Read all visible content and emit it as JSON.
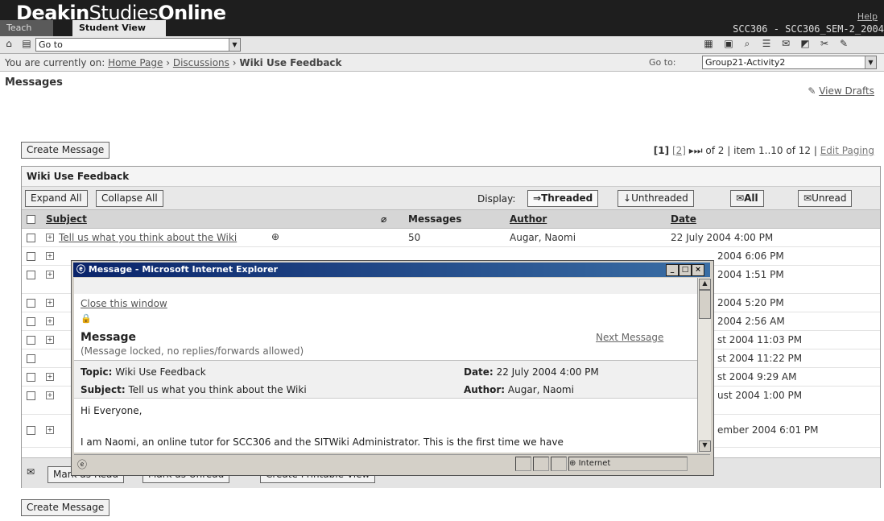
{
  "header": {
    "brand_part1": "Deakin",
    "brand_part2": "Studies",
    "brand_part3": "Online",
    "help": "Help",
    "tabs": [
      "Teach",
      "Student View"
    ],
    "course": "SCC306 - SCC306_SEM-2_2004"
  },
  "toolbar": {
    "goto_value": "Go to"
  },
  "breadcrumb": {
    "prefix": "You are currently on:",
    "items": [
      "Home Page",
      "Discussions"
    ],
    "current": "Wiki Use Feedback",
    "goto_label": "Go to:",
    "goto_value": "Group21-Activity2"
  },
  "page": {
    "title": "Messages",
    "view_drafts": "View Drafts",
    "create_message": "Create Message",
    "paging": {
      "current": "[1]",
      "next": "[2]",
      "of": "of 2 | item 1..10 of 12 |",
      "edit": "Edit Paging"
    }
  },
  "panel": {
    "title": "Wiki Use Feedback",
    "expand_all": "Expand All",
    "collapse_all": "Collapse All",
    "display_label": "Display:",
    "threaded": "Threaded",
    "unthreaded": "Unthreaded",
    "all": "All",
    "unread": "Unread",
    "columns": {
      "subject": "Subject",
      "messages": "Messages",
      "author": "Author",
      "date": "Date"
    },
    "rows": [
      {
        "subject": "Tell us what you think about the Wiki",
        "messages": "50",
        "author": "Augar, Naomi",
        "date": "22 July 2004 4:00 PM"
      },
      {
        "date": "2004 6:06 PM"
      },
      {
        "date": "2004 1:51 PM"
      },
      {
        "date": "2004 5:20 PM"
      },
      {
        "date": "2004 2:56 AM"
      },
      {
        "date": "st 2004 11:03 PM"
      },
      {
        "date": "st 2004 11:22 PM"
      },
      {
        "date": "st 2004 9:29 AM"
      },
      {
        "date": "ust 2004 1:00 PM"
      },
      {
        "date": "ember 2004 6:01 PM"
      }
    ],
    "mark_read": "Mark as Read",
    "mark_unread": "Mark as Unread",
    "printable": "Create Printable View"
  },
  "popup": {
    "title": "Message - Microsoft Internet Explorer",
    "close_link": "Close this window",
    "heading": "Message",
    "locked_note": "(Message locked, no replies/forwards allowed)",
    "next_message": "Next Message",
    "topic_label": "Topic:",
    "topic_value": "Wiki Use Feedback",
    "date_label": "Date:",
    "date_value": "22 July 2004 4:00 PM",
    "subject_label": "Subject:",
    "subject_value": "Tell us what you think about the Wiki",
    "author_label": "Author:",
    "author_value": "Augar, Naomi",
    "greeting": "Hi Everyone,",
    "body": "I am Naomi, an online tutor for SCC306 and the SITWiki Administrator. This is the first time we have",
    "status_zone": "Internet"
  }
}
